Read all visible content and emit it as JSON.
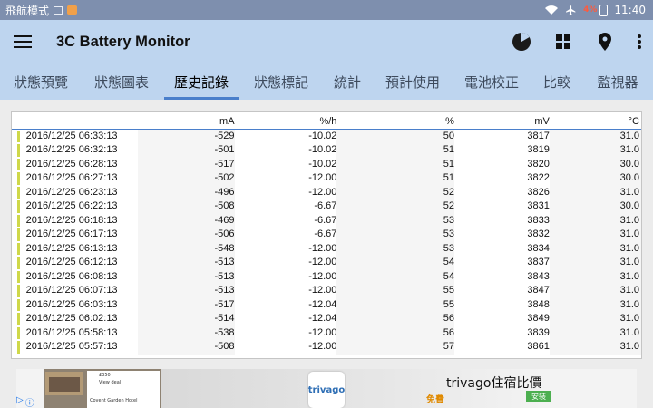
{
  "status_bar": {
    "carrier": "飛航模式",
    "battery_text": "4%",
    "time": "11:40"
  },
  "app": {
    "title": "3C Battery Monitor"
  },
  "icons": {
    "menu": "menu-icon",
    "pie": "pie-chart-icon",
    "grid": "grid-icon",
    "location": "location-pin-icon",
    "more": "more-vert-icon"
  },
  "tabs": [
    {
      "label": "狀態預覽",
      "active": false
    },
    {
      "label": "狀態圖表",
      "active": false
    },
    {
      "label": "歷史記錄",
      "active": true
    },
    {
      "label": "狀態標記",
      "active": false
    },
    {
      "label": "統計",
      "active": false
    },
    {
      "label": "預計使用",
      "active": false
    },
    {
      "label": "電池校正",
      "active": false
    },
    {
      "label": "比較",
      "active": false
    },
    {
      "label": "監視器",
      "active": false
    }
  ],
  "table": {
    "headers": [
      "mA",
      "%/h",
      "%",
      "mV",
      "°C"
    ],
    "rows": [
      {
        "time": "2016/12/25 06:33:13",
        "ma": "-529",
        "rate": "-10.02",
        "pct": "50",
        "mv": "3817",
        "temp": "31.0"
      },
      {
        "time": "2016/12/25 06:32:13",
        "ma": "-501",
        "rate": "-10.02",
        "pct": "51",
        "mv": "3819",
        "temp": "31.0"
      },
      {
        "time": "2016/12/25 06:28:13",
        "ma": "-517",
        "rate": "-10.02",
        "pct": "51",
        "mv": "3820",
        "temp": "30.0"
      },
      {
        "time": "2016/12/25 06:27:13",
        "ma": "-502",
        "rate": "-12.00",
        "pct": "51",
        "mv": "3822",
        "temp": "30.0"
      },
      {
        "time": "2016/12/25 06:23:13",
        "ma": "-496",
        "rate": "-12.00",
        "pct": "52",
        "mv": "3826",
        "temp": "31.0"
      },
      {
        "time": "2016/12/25 06:22:13",
        "ma": "-508",
        "rate": "-6.67",
        "pct": "52",
        "mv": "3831",
        "temp": "30.0"
      },
      {
        "time": "2016/12/25 06:18:13",
        "ma": "-469",
        "rate": "-6.67",
        "pct": "53",
        "mv": "3833",
        "temp": "31.0"
      },
      {
        "time": "2016/12/25 06:17:13",
        "ma": "-506",
        "rate": "-6.67",
        "pct": "53",
        "mv": "3832",
        "temp": "31.0"
      },
      {
        "time": "2016/12/25 06:13:13",
        "ma": "-548",
        "rate": "-12.00",
        "pct": "53",
        "mv": "3834",
        "temp": "31.0"
      },
      {
        "time": "2016/12/25 06:12:13",
        "ma": "-513",
        "rate": "-12.00",
        "pct": "54",
        "mv": "3837",
        "temp": "31.0"
      },
      {
        "time": "2016/12/25 06:08:13",
        "ma": "-513",
        "rate": "-12.00",
        "pct": "54",
        "mv": "3843",
        "temp": "31.0"
      },
      {
        "time": "2016/12/25 06:07:13",
        "ma": "-513",
        "rate": "-12.00",
        "pct": "55",
        "mv": "3847",
        "temp": "31.0"
      },
      {
        "time": "2016/12/25 06:03:13",
        "ma": "-517",
        "rate": "-12.04",
        "pct": "55",
        "mv": "3848",
        "temp": "31.0"
      },
      {
        "time": "2016/12/25 06:02:13",
        "ma": "-514",
        "rate": "-12.04",
        "pct": "56",
        "mv": "3849",
        "temp": "31.0"
      },
      {
        "time": "2016/12/25 05:58:13",
        "ma": "-538",
        "rate": "-12.00",
        "pct": "56",
        "mv": "3839",
        "temp": "31.0"
      },
      {
        "time": "2016/12/25 05:57:13",
        "ma": "-508",
        "rate": "-12.00",
        "pct": "57",
        "mv": "3861",
        "temp": "31.0"
      }
    ]
  },
  "ad": {
    "title": "trivago住宿比價",
    "subtitle": "免費",
    "install_label": "安裝",
    "logo_text": "trivago",
    "hotel_name": "Covent Garden Hotel",
    "price": "£350",
    "deal_label": "View deal"
  },
  "colors": {
    "appbar": "#bed5ef",
    "status_bar": "#7e8fae",
    "tab_indicator": "#4a7fcb",
    "row_marker": "#cfd84a"
  }
}
